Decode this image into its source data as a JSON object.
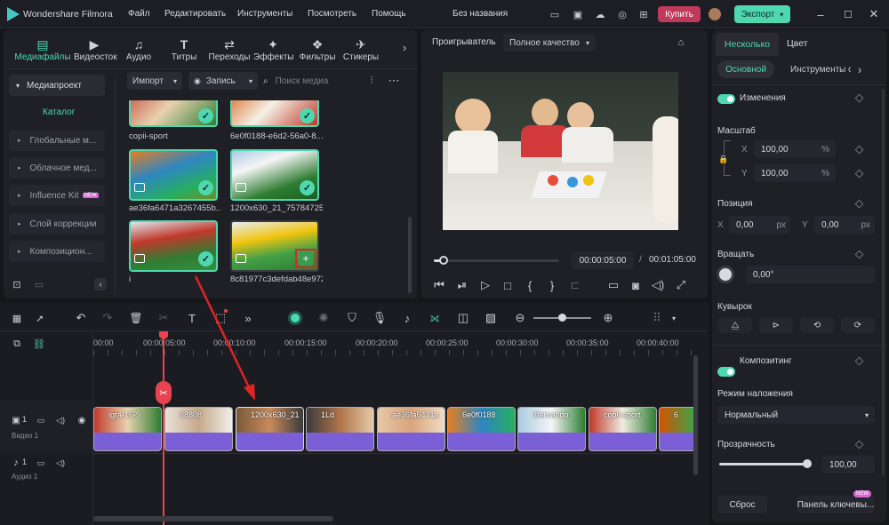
{
  "app": {
    "title": "Wondershare Filmora",
    "project": "Без названия"
  },
  "menu": [
    "Файл",
    "Редактировать",
    "Инструменты",
    "Посмотреть",
    "Помощь"
  ],
  "header": {
    "buy": "Купить",
    "export": "Экспорт"
  },
  "media_tabs": [
    {
      "label": "Медиафайлы",
      "icon": "media-icon"
    },
    {
      "label": "Видеосток",
      "icon": "stock-video-icon"
    },
    {
      "label": "Аудио",
      "icon": "music-icon"
    },
    {
      "label": "Титры",
      "icon": "titles-icon"
    },
    {
      "label": "Переходы",
      "icon": "transitions-icon"
    },
    {
      "label": "Эффекты",
      "icon": "effects-icon"
    },
    {
      "label": "Фильтры",
      "icon": "filters-icon"
    },
    {
      "label": "Стикеры",
      "icon": "stickers-icon"
    }
  ],
  "sidebar": {
    "project": "Медиапроект",
    "catalog": "Каталог",
    "items": [
      "Глобальные м...",
      "Облачное мед...",
      "Influence Kit",
      "Слой коррекции",
      "Композицион..."
    ],
    "new_badge": "NEW"
  },
  "media_toolbar": {
    "import": "Импорт",
    "record": "Запись",
    "search_placeholder": "Поиск медиа"
  },
  "media_items": [
    {
      "name": "copii-sport"
    },
    {
      "name": "6e0f0188-e6d2-56a0-8..."
    },
    {
      "name": "ae36fa6471a3267455b..."
    },
    {
      "name": "1200x630_21_75784725..."
    },
    {
      "name": "i"
    },
    {
      "name": "8c81977c3defdab48e972"
    }
  ],
  "player": {
    "label": "Проигрыватель",
    "quality": "Полное качество",
    "current": "00:00:05:00",
    "total": "00:01:05:00",
    "progress": 0.08
  },
  "timeline": {
    "ruler": [
      "00:00",
      "00:00:05:00",
      "00:00:10:00",
      "00:00:15:00",
      "00:00:20:00",
      "00:00:25:00",
      "00:00:30:00",
      "00:00:35:00",
      "00:00:40:00"
    ],
    "video_track": "Видео 1",
    "audio_track": "Аудио 1",
    "track_num": "1",
    "clips": [
      "igra-16-9",
      "88808",
      "1200x630_21",
      "1Ld",
      "ae36fa6471a",
      "6e0f0188",
      "3fernando",
      "copii-sport",
      "6"
    ]
  },
  "props": {
    "tabs": [
      "Несколько",
      "Цвет"
    ],
    "subtabs": [
      "Основной",
      "Инструменты с"
    ],
    "changes": "Изменения",
    "scale": "Масштаб",
    "scale_x": "100,00",
    "scale_y": "100,00",
    "pct": "%",
    "position": "Позиция",
    "pos_x": "0,00",
    "pos_y": "0,00",
    "px": "px",
    "x": "X",
    "y": "Y",
    "rotate": "Вращать",
    "rotate_val": "0,00°",
    "flip": "Кувырок",
    "compositing": "Композитинг",
    "blend_mode": "Режим наложения",
    "blend_value": "Нормальный",
    "opacity": "Прозрачность",
    "opacity_val": "100,00",
    "reset": "Сброс",
    "keyframes": "Панель ключевы...",
    "new_badge": "NEW"
  },
  "colors": {
    "accent": "#4fd8b0",
    "playhead": "#e8434f",
    "clip": "#7b5fd6",
    "buy": "#c0395a"
  }
}
